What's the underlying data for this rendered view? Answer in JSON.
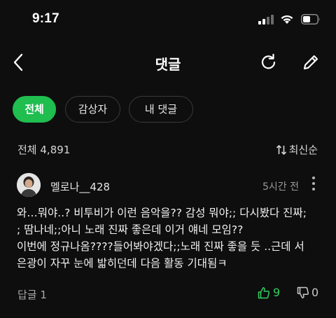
{
  "status_bar": {
    "time": "9:17"
  },
  "header": {
    "title": "댓글"
  },
  "filters": [
    {
      "label": "전체",
      "selected": true
    },
    {
      "label": "감상자",
      "selected": false
    },
    {
      "label": "내 댓글",
      "selected": false
    }
  ],
  "summary": {
    "label": "전체",
    "count": "4,891",
    "sort_label": "최신순"
  },
  "comment": {
    "author": "멜로나__428",
    "time": "5시간 전",
    "lines": [
      "와…뭐야..? 비투비가 이런 음악을?? 감성 뭐야;; 다시봤다 진짜;",
      "; 땀나네;;아니 노래 진짜 좋은데 이거 얘네 모임??",
      "이번에 정규나옴????들어봐야겠다;;노래 진짜 좋을 듯 ..근데 서",
      "은광이 자꾸 눈에 밟히던데 다음 활동 기대됨ㅋ"
    ],
    "reply_label": "답글 1",
    "likes": "9",
    "dislikes": "0"
  },
  "colors": {
    "accent": "#1fbe4f",
    "background": "#0e0e0e",
    "like": "#2fd05f"
  }
}
